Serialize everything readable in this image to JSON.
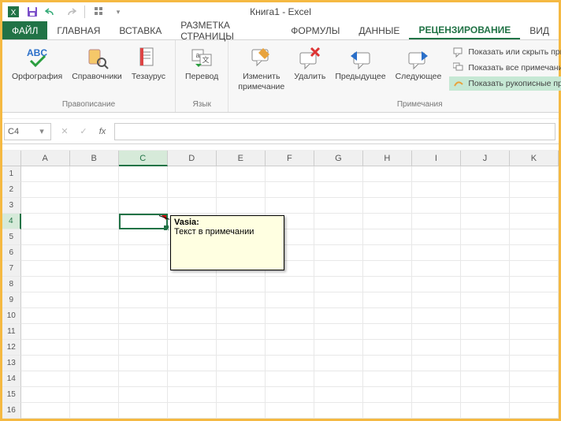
{
  "app_title": "Книга1 - Excel",
  "qat": {
    "save": "save",
    "undo": "undo",
    "redo": "redo",
    "touch": "touch-mode",
    "more": "more"
  },
  "tabs": {
    "file": "ФАЙЛ",
    "home": "ГЛАВНАЯ",
    "insert": "ВСТАВКА",
    "pagelayout": "РАЗМЕТКА СТРАНИЦЫ",
    "formulas": "ФОРМУЛЫ",
    "data": "ДАННЫЕ",
    "review": "РЕЦЕНЗИРОВАНИЕ",
    "view": "ВИД"
  },
  "ribbon": {
    "proofing": {
      "label": "Правописание",
      "spelling": "Орфография",
      "research": "Справочники",
      "thesaurus": "Тезаурус"
    },
    "language": {
      "label": "Язык",
      "translate": "Перевод"
    },
    "comments": {
      "label": "Примечания",
      "edit": "Изменить\nпримечание",
      "delete": "Удалить",
      "previous": "Предыдущее",
      "next": "Следующее",
      "show_hide": "Показать или скрыть примечание",
      "show_all": "Показать все примечания",
      "show_ink": "Показать рукописные примечания"
    }
  },
  "namebox": "C4",
  "columns": [
    "A",
    "B",
    "C",
    "D",
    "E",
    "F",
    "G",
    "H",
    "I",
    "J",
    "K"
  ],
  "active_col_index": 2,
  "active_row_index": 3,
  "row_count": 16,
  "comment": {
    "author": "Vasia:",
    "text": "Текст в примечании"
  }
}
